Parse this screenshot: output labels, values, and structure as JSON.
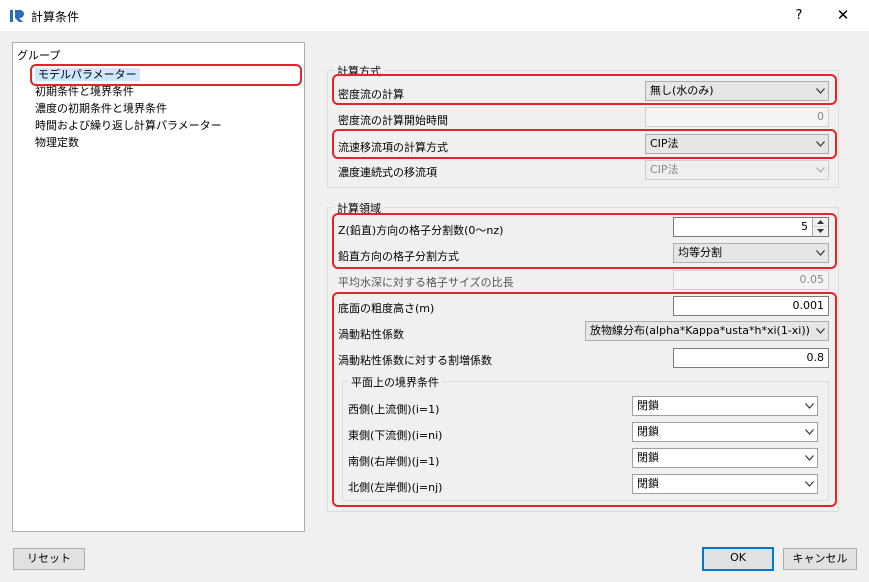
{
  "window": {
    "title": "計算条件",
    "help": "?",
    "close": "✕"
  },
  "groups": {
    "header": "グループ",
    "items": [
      "モデルパラメーター",
      "初期条件と境界条件",
      "濃度の初期条件と境界条件",
      "時間および繰り返し計算パラメーター",
      "物理定数"
    ]
  },
  "calc_method": {
    "title": "計算方式",
    "density_flow": {
      "label": "密度流の計算",
      "value": "無し(水のみ)"
    },
    "density_start": {
      "label": "密度流の計算開始時間",
      "value": "0"
    },
    "advection": {
      "label": "流速移流項の計算方式",
      "value": "CIP法"
    },
    "concentration_advection": {
      "label": "濃度連続式の移流項",
      "value": "CIP法"
    }
  },
  "calc_domain": {
    "title": "計算領域",
    "z_divisions": {
      "label": "Z(鉛直)方向の格子分割数(0〜nz)",
      "value": "5"
    },
    "vertical_method": {
      "label": "鉛直方向の格子分割方式",
      "value": "均等分割"
    },
    "grid_ratio": {
      "label": "平均水深に対する格子サイズの比長",
      "value": "0.05"
    },
    "roughness": {
      "label": "底面の粗度高さ(m)",
      "value": "0.001"
    },
    "eddy_viscosity": {
      "label": "渦動粘性係数",
      "value": "放物線分布(alpha*Kappa*usta*h*xi(1-xi))"
    },
    "eddy_factor": {
      "label": "渦動粘性係数に対する割増係数",
      "value": "0.8"
    },
    "boundary": {
      "title": "平面上の境界条件",
      "west": {
        "label": "西側(上流側)(i=1)",
        "value": "閉鎖"
      },
      "east": {
        "label": "東側(下流側)(i=ni)",
        "value": "閉鎖"
      },
      "south": {
        "label": "南側(右岸側)(j=1)",
        "value": "閉鎖"
      },
      "north": {
        "label": "北側(左岸側)(j=nj)",
        "value": "閉鎖"
      }
    }
  },
  "buttons": {
    "reset": "リセット",
    "ok": "OK",
    "cancel": "キャンセル"
  },
  "colors": {
    "highlight": "#e0262a",
    "selection": "#cce8ff",
    "accent": "#0078d7"
  }
}
